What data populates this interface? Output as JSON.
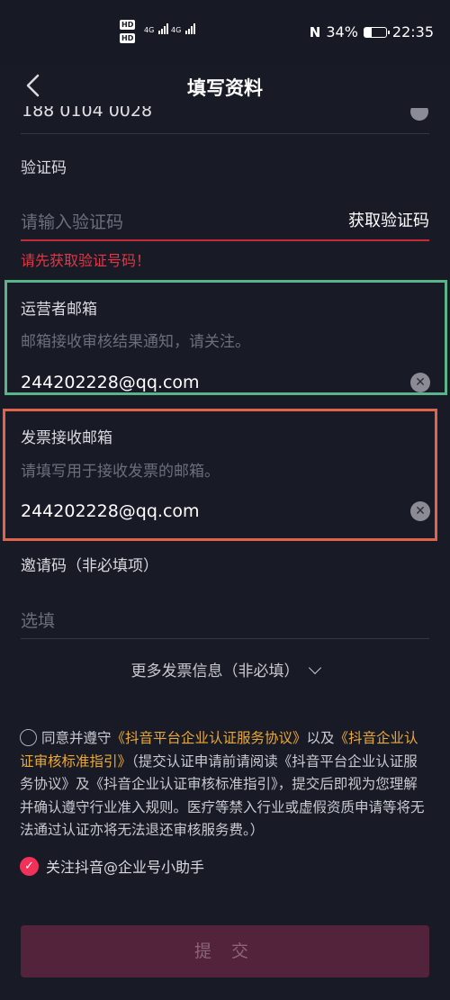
{
  "status_bar": {
    "hd1": "HD",
    "hd2": "HD",
    "net1": "4G",
    "net2": "4G",
    "battery": "34%",
    "battery_level": 0.34,
    "time": "22:35"
  },
  "nav": {
    "title": "填写资料"
  },
  "phone": {
    "value_partial": "188 0104 0028"
  },
  "code": {
    "label": "验证码",
    "placeholder": "请输入验证码",
    "get_code": "获取验证码",
    "error": "请先获取验证号码！"
  },
  "operator_email": {
    "label": "运营者邮箱",
    "hint": "邮箱接收审核结果通知，请关注。",
    "value": "244202228@qq.com"
  },
  "invoice_email": {
    "label": "发票接收邮箱",
    "hint": "请填写用于接收发票的邮箱。",
    "value": "244202228@qq.com"
  },
  "invite": {
    "label": "邀请码（非必填项）",
    "placeholder": "选填"
  },
  "more_info": "更多发票信息（非必填）",
  "agreement": {
    "prefix": "同意并遵守",
    "link1": "《抖音平台企业认证服务协议》",
    "mid": "以及",
    "link2": "《抖音企业认证审核标准指引》",
    "notice": "（提交认证申请前请阅读《抖音平台企业认证服务协议》及《抖音企业认证审核标准指引》，提交后即视为您理解并确认遵守行业准入规则。医疗等禁入行业或虚假资质申请等将无法通过认证亦将无法退还审核服务费。）"
  },
  "follow": {
    "label": "关注抖音@企业号小助手",
    "checked": true
  },
  "submit": "提 交",
  "colors": {
    "accent": "#f2315a",
    "link": "#e9a93a",
    "error": "#e23744",
    "highlight_green": "#5ab48a",
    "highlight_red": "#e0634c"
  }
}
